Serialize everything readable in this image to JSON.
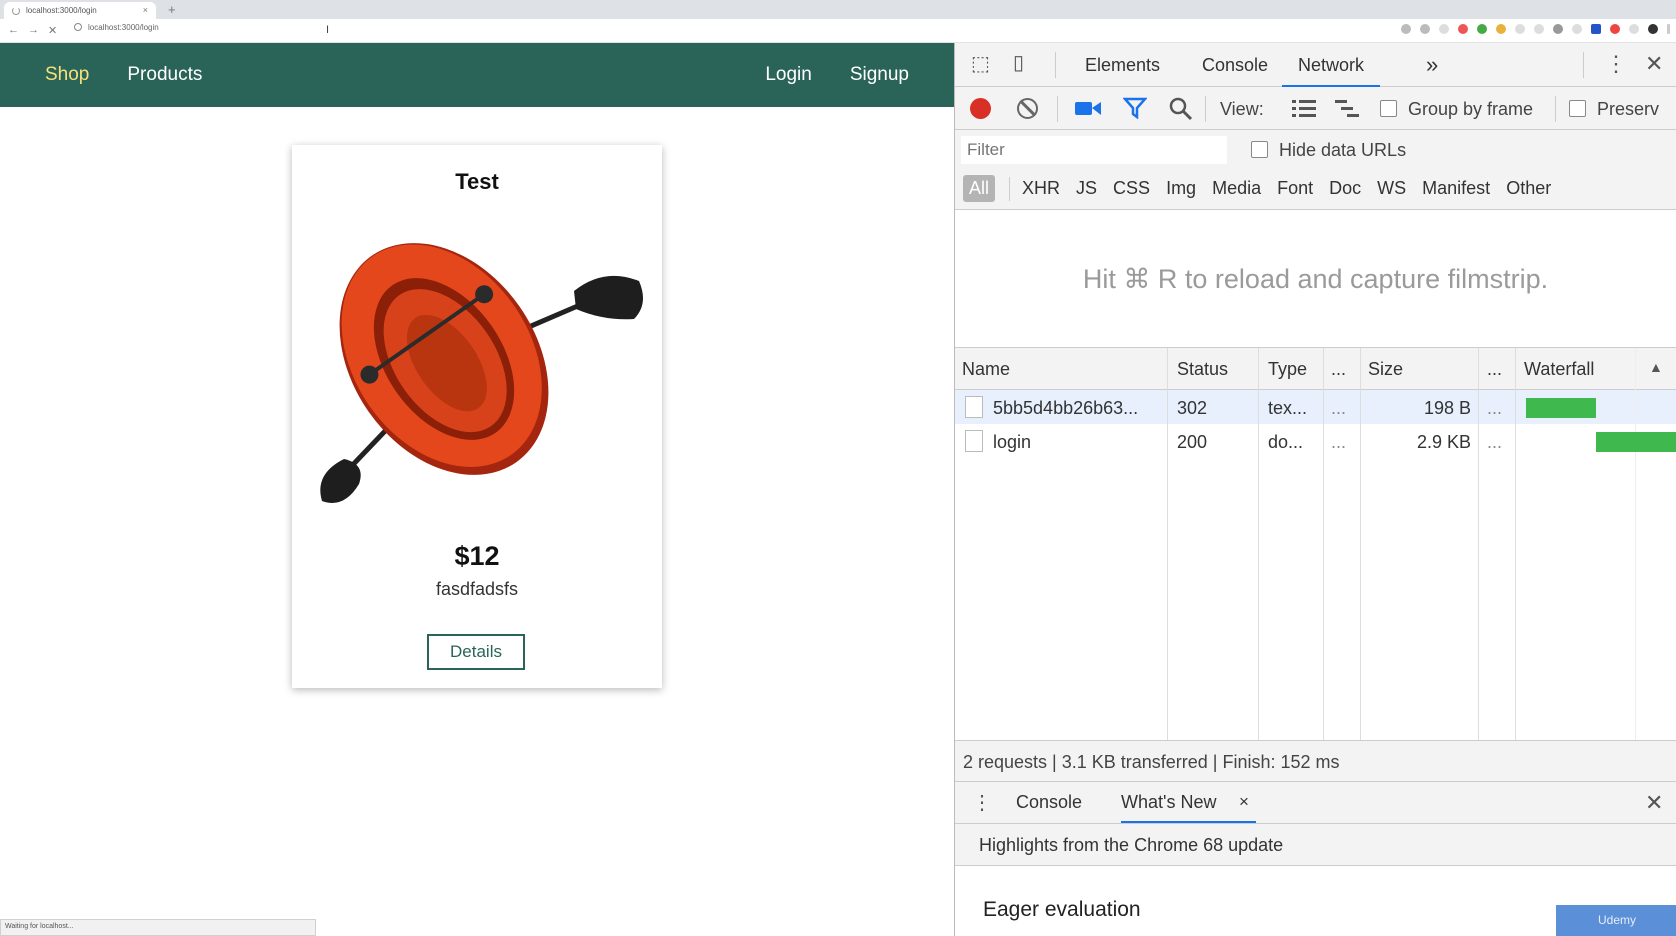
{
  "browser": {
    "tab_title": "localhost:3000/login",
    "tab_close": "×",
    "new_tab": "+",
    "url": "localhost:3000/login",
    "status_text": "Waiting for localhost..."
  },
  "shop": {
    "nav": {
      "shop": "Shop",
      "products": "Products",
      "login": "Login",
      "signup": "Signup"
    },
    "product": {
      "title": "Test",
      "price": "$12",
      "description": "fasdfadsfs",
      "details_button": "Details"
    },
    "colors": {
      "header": "#2a6459",
      "active_nav": "#f5e27a"
    }
  },
  "devtools": {
    "tabs": [
      "Elements",
      "Console",
      "Network"
    ],
    "active_tab": "Network",
    "more_tabs": "»",
    "toolbar": {
      "view_label": "View:",
      "group_by_frame": "Group by frame",
      "preserve_log": "Preserv"
    },
    "filter": {
      "placeholder": "Filter",
      "hide_data_urls": "Hide data URLs",
      "types": [
        "All",
        "XHR",
        "JS",
        "CSS",
        "Img",
        "Media",
        "Font",
        "Doc",
        "WS",
        "Manifest",
        "Other"
      ]
    },
    "filmstrip_hint": "Hit ⌘ R to reload and capture filmstrip.",
    "table": {
      "columns": [
        "Name",
        "Status",
        "Type",
        "...",
        "Size",
        "...",
        "Waterfall"
      ],
      "sort_indicator": "▲",
      "rows": [
        {
          "name": "5bb5d4bb26b63...",
          "status": "302",
          "type": "tex...",
          "dots": "...",
          "size": "198 B",
          "dots2": "..."
        },
        {
          "name": "login",
          "status": "200",
          "type": "do...",
          "dots": "...",
          "size": "2.9 KB",
          "dots2": "..."
        }
      ]
    },
    "summary": "2 requests | 3.1 KB transferred | Finish: 152 ms",
    "drawer": {
      "tabs": [
        "Console",
        "What's New"
      ],
      "close_tab": "×",
      "highlights": "Highlights from the Chrome 68 update",
      "section_title": "Eager evaluation",
      "watermark": "Udemy"
    },
    "colors": {
      "record": "#d93025",
      "accent": "#1a73e8",
      "waterfall": "#3fb94e"
    }
  }
}
